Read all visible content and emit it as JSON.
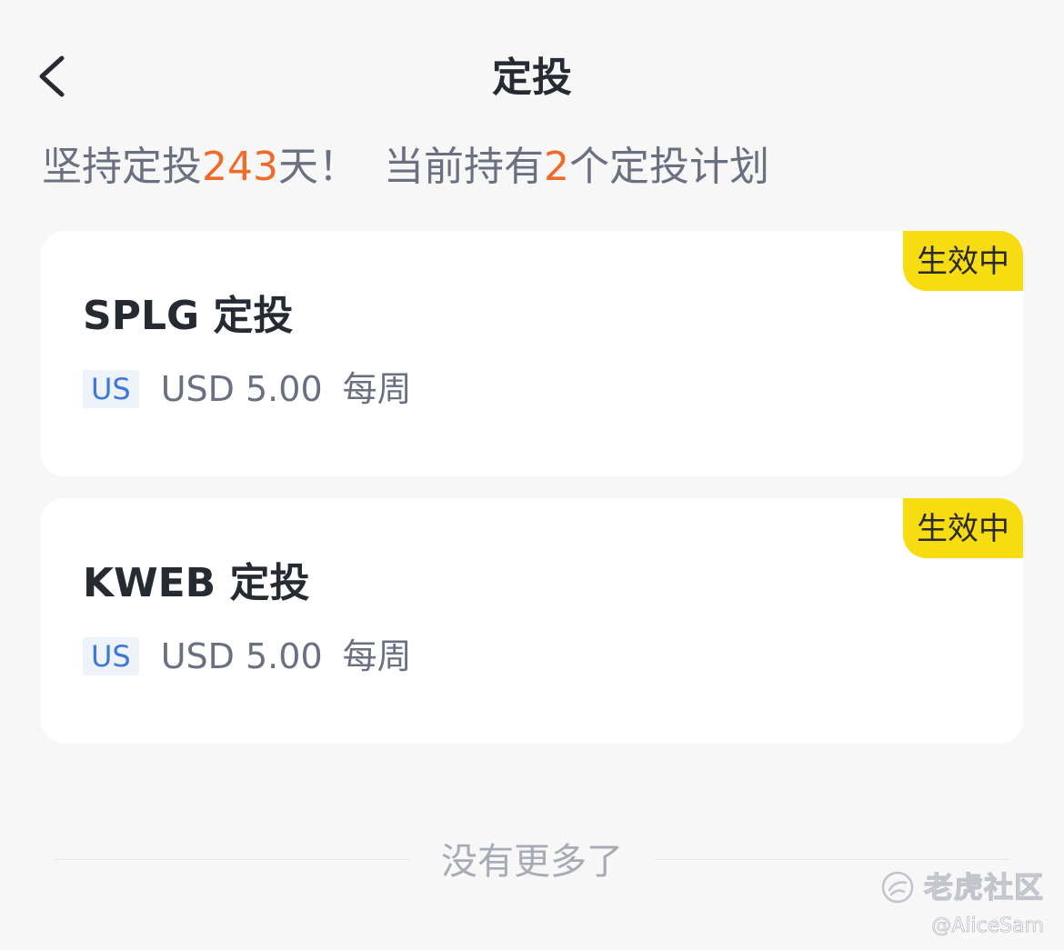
{
  "header": {
    "title": "定投",
    "back_icon": "chevron-left-icon"
  },
  "summary": {
    "prefix": "坚持定投",
    "days": "243",
    "days_suffix": "天！",
    "plans_prefix": "当前持有",
    "plans_count": "2",
    "plans_suffix": "个定投计划"
  },
  "plans": [
    {
      "name": "SPLG 定投",
      "status": "生效中",
      "market": "US",
      "amount": "USD 5.00",
      "frequency": "每周"
    },
    {
      "name": "KWEB 定投",
      "status": "生效中",
      "market": "US",
      "amount": "USD 5.00",
      "frequency": "每周"
    }
  ],
  "footer": {
    "no_more": "没有更多了"
  },
  "watermark": {
    "brand": "老虎社区",
    "user": "@AliceSam"
  },
  "colors": {
    "background": "#f7f7f8",
    "highlight": "#f06a2a",
    "badge": "#f8dc12",
    "market_tag_text": "#3d78d8",
    "market_tag_bg": "#edf2fb"
  }
}
